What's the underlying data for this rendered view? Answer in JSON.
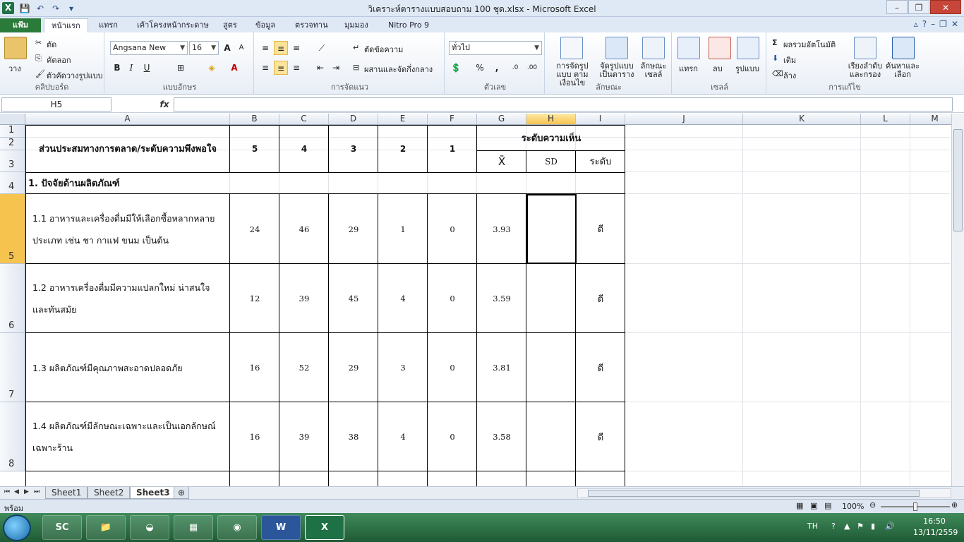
{
  "window": {
    "title": "วิเคราะห์ตารางแบบสอบถาม 100 ชุด.xlsx - Microsoft Excel",
    "app_icon": "X",
    "minimize": "–",
    "restore": "❐",
    "close": "✕"
  },
  "ribbon_tabs": {
    "file": "แฟ้ม",
    "items": [
      "หน้าแรก",
      "แทรก",
      "เค้าโครงหน้ากระดาษ",
      "สูตร",
      "ข้อมูล",
      "ตรวจทาน",
      "มุมมอง",
      "Nitro Pro 9"
    ]
  },
  "clipboard": {
    "label": "คลิปบอร์ด",
    "paste": "วาง",
    "cut": "ตัด",
    "copy": "คัดลอก",
    "format_painter": "ตัวคัดวางรูปแบบ"
  },
  "font": {
    "label": "แบบอักษร",
    "name": "Angsana New",
    "size": "16"
  },
  "alignment": {
    "label": "การจัดแนว",
    "wrap": "ตัดข้อความ",
    "merge": "ผสานและจัดกึ่งกลาง"
  },
  "number": {
    "label": "ตัวเลข",
    "format": "ทั่วไป"
  },
  "styles": {
    "label": "ลักษณะ",
    "conditional": "การจัดรูปแบบ ตามเงื่อนไข",
    "as_table": "จัดรูปแบบ เป็นตาราง",
    "cell_styles": "ลักษณะ เซลล์"
  },
  "cells": {
    "label": "เซลล์",
    "insert": "แทรก",
    "delete": "ลบ",
    "format": "รูปแบบ"
  },
  "editing": {
    "label": "การแก้ไข",
    "autosum": "ผลรวมอัตโนมัติ",
    "fill": "เติม",
    "clear": "ล้าง",
    "sort": "เรียงลำดับ และกรอง",
    "find": "ค้นหาและ เลือก"
  },
  "formula_bar": {
    "name_box": "H5",
    "fx": "fx",
    "value": ""
  },
  "columns": [
    "A",
    "B",
    "C",
    "D",
    "E",
    "F",
    "G",
    "H",
    "I",
    "J",
    "K",
    "L",
    "M"
  ],
  "rows": [
    "1",
    "2",
    "3",
    "4",
    "5",
    "6",
    "7",
    "8"
  ],
  "table": {
    "header_main": "ส่วนประสมทางการตลาด/ระดับความพึงพอใจ",
    "scale": [
      "5",
      "4",
      "3",
      "2",
      "1"
    ],
    "opinion": "ระดับความเห็น",
    "mean": "X̄",
    "sd": "SD",
    "level": "ระดับ",
    "section": "1. ปัจจัยด้านผลิตภัณฑ์",
    "items": [
      {
        "text": "1.1 อาหารและเครื่องดื่มมีให้เลือกซื้อหลากหลาย ประเภท เช่น ชา กาแฟ ขนม เป็นต้น",
        "v5": "24",
        "v4": "46",
        "v3": "29",
        "v2": "1",
        "v1": "0",
        "mean": "3.93",
        "sd": "",
        "level": "ดี"
      },
      {
        "text": "1.2 อาหารเครื่องดื่มมีความแปลกใหม่ น่าสนใจ และทันสมัย",
        "v5": "12",
        "v4": "39",
        "v3": "45",
        "v2": "4",
        "v1": "0",
        "mean": "3.59",
        "sd": "",
        "level": "ดี"
      },
      {
        "text": "1.3 ผลิตภัณฑ์มีคุณภาพสะอาดปลอดภัย",
        "v5": "16",
        "v4": "52",
        "v3": "29",
        "v2": "3",
        "v1": "0",
        "mean": "3.81",
        "sd": "",
        "level": "ดี"
      },
      {
        "text": "1.4 ผลิตภัณฑ์มีลักษณะเฉพาะและเป็นเอกลักษณ์ เฉพาะร้าน",
        "v5": "16",
        "v4": "39",
        "v3": "38",
        "v2": "4",
        "v1": "0",
        "mean": "3.58",
        "sd": "",
        "level": "ดี"
      }
    ]
  },
  "sheets": [
    "Sheet1",
    "Sheet2",
    "Sheet3"
  ],
  "active_sheet": "Sheet3",
  "status": {
    "ready": "พร้อม",
    "zoom": "100%"
  },
  "taskbar": {
    "apps": [
      "SC",
      "W",
      "X"
    ],
    "lang": "TH",
    "time": "16:50",
    "date": "13/11/2559"
  }
}
